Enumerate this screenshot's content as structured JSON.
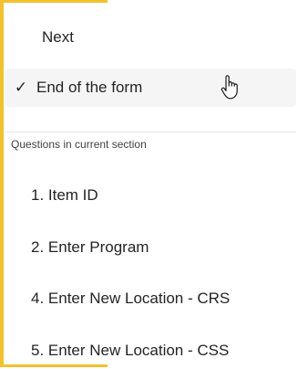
{
  "menu": {
    "items": [
      {
        "label": "Next",
        "checked": false
      },
      {
        "label": "End of the form",
        "checked": true
      }
    ],
    "check_icon": "checkmark-icon"
  },
  "section": {
    "header": "Questions in current section",
    "questions": [
      "1. Item ID",
      "2. Enter Program",
      "4. Enter New Location - CRS",
      "5. Enter New Location - CSS"
    ]
  },
  "colors": {
    "accent": "#f2c12e",
    "selected_bg": "#f5f5f5",
    "text": "#242424"
  }
}
